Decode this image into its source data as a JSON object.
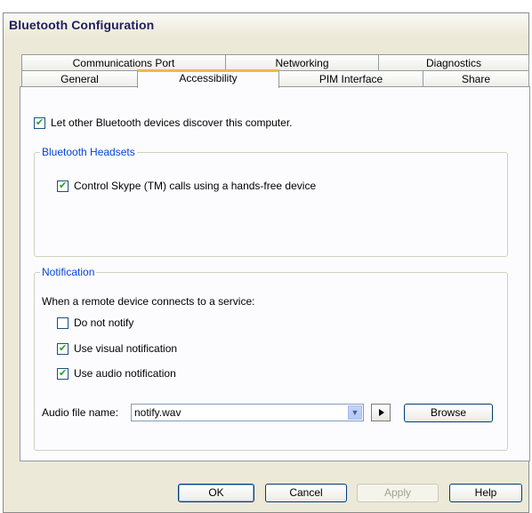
{
  "window": {
    "title": "Bluetooth Configuration"
  },
  "tabs": {
    "row1": [
      {
        "label": "Communications Port"
      },
      {
        "label": "Networking"
      },
      {
        "label": "Diagnostics"
      }
    ],
    "row2": [
      {
        "label": "General"
      },
      {
        "label": "Accessibility"
      },
      {
        "label": "PIM Interface"
      },
      {
        "label": "Share"
      }
    ],
    "active": "Accessibility"
  },
  "discover": {
    "label": "Let other Bluetooth devices discover this computer.",
    "checked": true
  },
  "headsets": {
    "legend": "Bluetooth Headsets",
    "skype": {
      "label": "Control Skype (TM) calls using a hands-free device",
      "checked": true
    }
  },
  "notification": {
    "legend": "Notification",
    "intro": "When a remote device connects to a service:",
    "options": [
      {
        "label": "Do not notify",
        "checked": false
      },
      {
        "label": "Use visual notification",
        "checked": true
      },
      {
        "label": "Use audio notification",
        "checked": true
      }
    ],
    "audio_label": "Audio file name:",
    "audio_value": "notify.wav",
    "browse": "Browse"
  },
  "buttons": {
    "ok": "OK",
    "cancel": "Cancel",
    "apply": "Apply",
    "help": "Help"
  },
  "colors": {
    "accent": "#f0b94a",
    "legend": "#0046d5",
    "check": "#21a121"
  }
}
